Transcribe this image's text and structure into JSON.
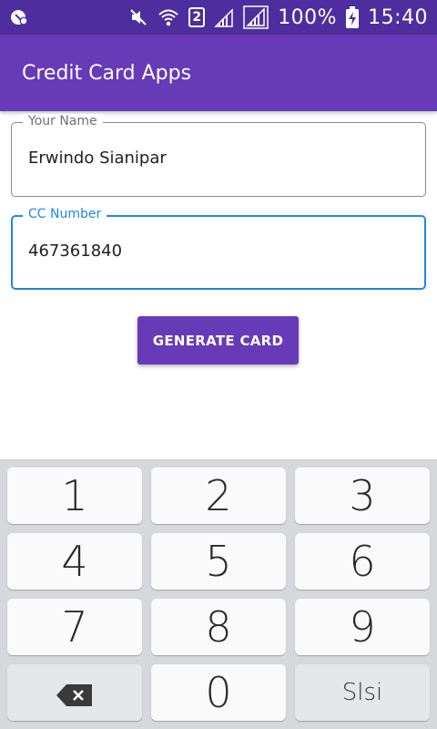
{
  "status_bar": {
    "battery_percent": "100%",
    "time": "15:40",
    "sim_slot": "2"
  },
  "app_bar": {
    "title": "Credit Card Apps"
  },
  "form": {
    "name_field": {
      "label": "Your Name",
      "value": "Erwindo Sianipar"
    },
    "cc_field": {
      "label": "CC Number",
      "value": "467361840"
    },
    "generate_label": "GENERATE CARD"
  },
  "keyboard": {
    "keys": [
      "1",
      "2",
      "3",
      "4",
      "5",
      "6",
      "7",
      "8",
      "9",
      "⌫",
      "0",
      "Slsi"
    ]
  },
  "colors": {
    "primary": "#673ab7",
    "status_bar": "#4e2e9e",
    "focus": "#1e88e5"
  }
}
